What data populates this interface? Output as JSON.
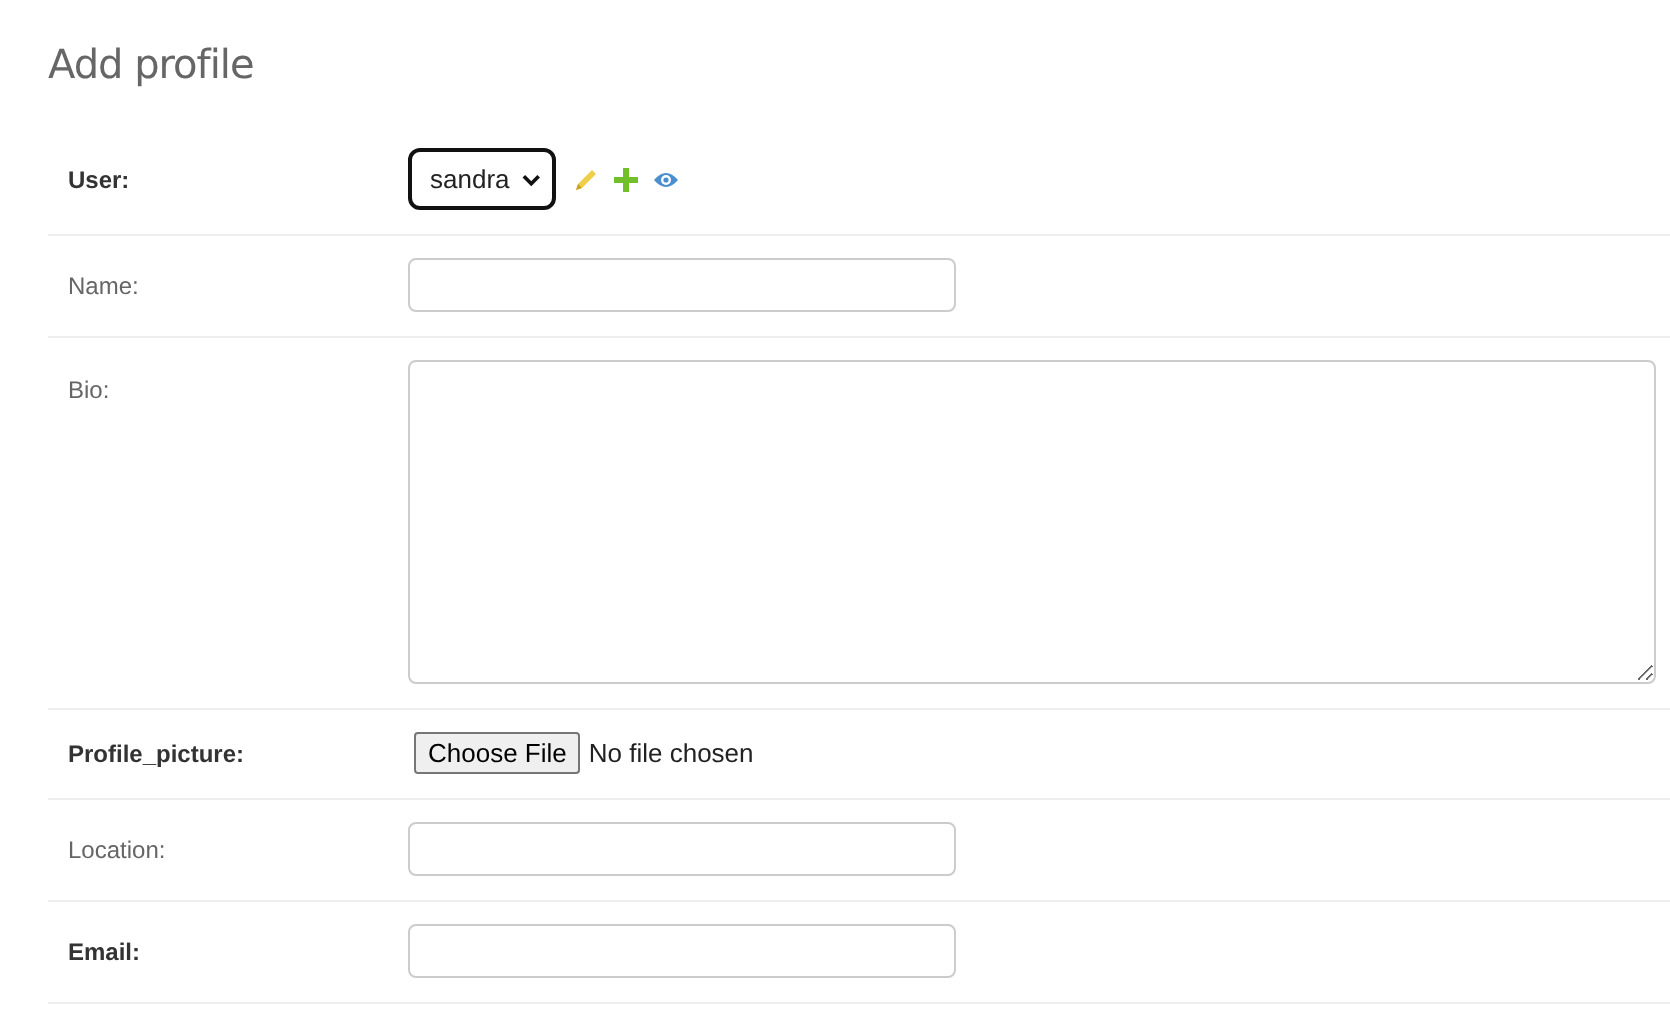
{
  "title": "Add profile",
  "fields": [
    {
      "label": "User:",
      "required": true,
      "kind": "select",
      "value": "sandra"
    },
    {
      "label": "Name:",
      "required": false,
      "kind": "text"
    },
    {
      "label": "Bio:",
      "required": false,
      "kind": "textarea"
    },
    {
      "label": "Profile_picture:",
      "required": true,
      "kind": "file",
      "button": "Choose File",
      "status": "No file chosen"
    },
    {
      "label": "Location:",
      "required": false,
      "kind": "text"
    },
    {
      "label": "Email:",
      "required": true,
      "kind": "text"
    }
  ]
}
